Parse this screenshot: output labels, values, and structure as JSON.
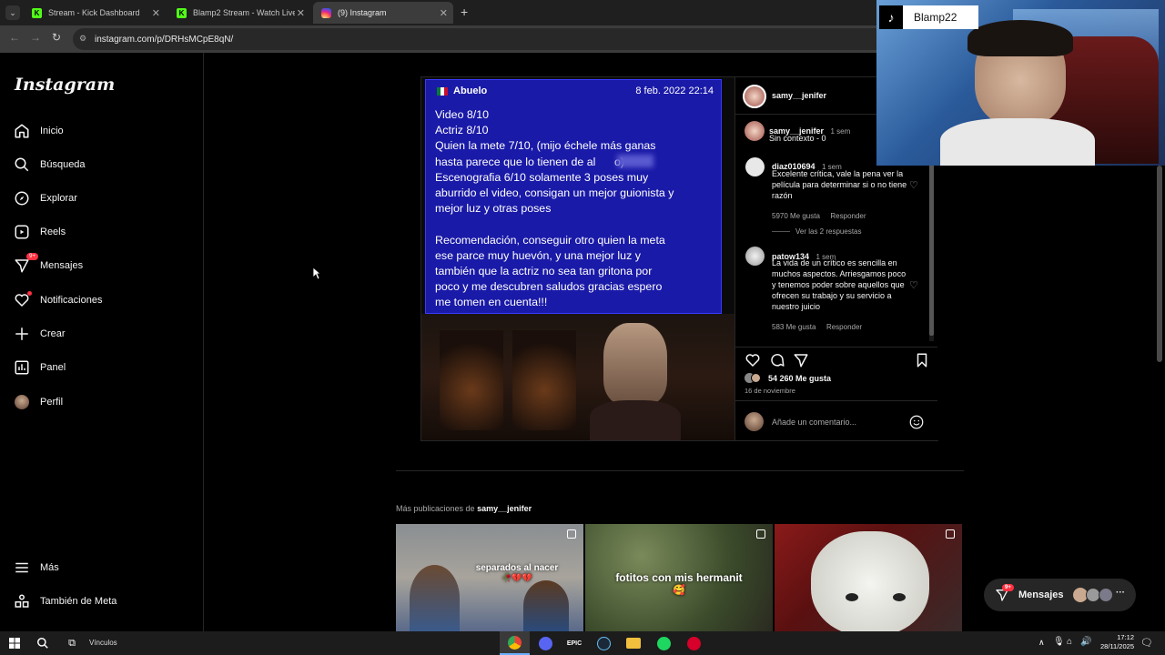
{
  "browser": {
    "tabs": [
      {
        "title": "Stream - Kick Dashboard",
        "active": false,
        "favicon": "kick-icon"
      },
      {
        "title": "Blamp2 Stream - Watch Live on Kick",
        "active": false,
        "favicon": "kick-icon"
      },
      {
        "title": "(9) Instagram",
        "active": true,
        "favicon": "instagram-icon"
      }
    ],
    "url": "instagram.com/p/DRHsMCpE8qN/"
  },
  "sidebar": {
    "logo": "Instagram",
    "items": [
      {
        "label": "Inicio",
        "icon": "home-icon"
      },
      {
        "label": "Búsqueda",
        "icon": "search-icon"
      },
      {
        "label": "Explorar",
        "icon": "compass-icon"
      },
      {
        "label": "Reels",
        "icon": "reels-icon"
      },
      {
        "label": "Mensajes",
        "icon": "messenger-icon",
        "badge": "9+"
      },
      {
        "label": "Notificaciones",
        "icon": "heart-icon"
      },
      {
        "label": "Crear",
        "icon": "plus-icon"
      },
      {
        "label": "Panel",
        "icon": "dashboard-icon"
      },
      {
        "label": "Perfil",
        "icon": "avatar"
      }
    ],
    "bottom": [
      {
        "label": "Más",
        "icon": "menu-icon"
      },
      {
        "label": "También de Meta",
        "icon": "meta-icon"
      }
    ]
  },
  "post": {
    "image": {
      "sender": "Abuelo",
      "date": "8 feb. 2022 22:14",
      "text": "Video 8/10\nActriz 8/10\nQuien la mete 7/10, (mijo échele más ganas\nhasta parece que lo tienen de al      o)\nEscenografia 6/10 solamente 3 poses muy\naburrido el video, consigan un mejor guionista y\nmejor luz y otras poses\n\nRecomendación, conseguir otro quien la meta\nese parce muy huevón, y una mejor luz y\ntambién que la actriz no sea tan gritona por\npoco y me descubren saludos gracias espero\nme tomen en cuenta!!!"
    },
    "author": "samy__jenifer",
    "caption": {
      "user": "samy__jenifer",
      "time": "1 sem",
      "text": "Sin contexto - 0"
    },
    "comments": [
      {
        "user": "diaz010694",
        "time": "1 sem",
        "text": "Excelente crítica, vale la pena ver la película para determinar si o no tiene razón",
        "likes": "5970 Me gusta",
        "reply": "Responder",
        "replies": "Ver las 2 respuestas"
      },
      {
        "user": "patow134",
        "time": "1 sem",
        "text": "La vida de un crítico es sencilla en muchos aspectos. Arriesgamos poco y tenemos poder sobre aquellos que ofrecen su trabajo y su servicio a nuestro juicio",
        "likes": "583 Me gusta",
        "reply": "Responder"
      }
    ],
    "likes": "54 260 Me gusta",
    "date": "16 de noviembre",
    "comment_placeholder": "Añade un comentario..."
  },
  "more": {
    "prefix": "Más publicaciones de",
    "user": "samy__jenifer",
    "thumbs": [
      {
        "caption": "separados al nacer",
        "emoji": "🥀💔💔"
      },
      {
        "caption": "fotitos con mis hermanit",
        "emoji": "🥰"
      },
      {
        "caption": "",
        "emoji": ""
      }
    ]
  },
  "messages_pill": {
    "label": "Mensajes",
    "badge": "9+"
  },
  "stream_overlay": {
    "username": "Blamp22"
  },
  "taskbar": {
    "search_label": "Vínculos",
    "time": "17:12",
    "date": "28/11/2025"
  },
  "colors": {
    "accent_blue": "#1a1aa8",
    "badge_red": "#ff3040",
    "background": "#000000"
  }
}
